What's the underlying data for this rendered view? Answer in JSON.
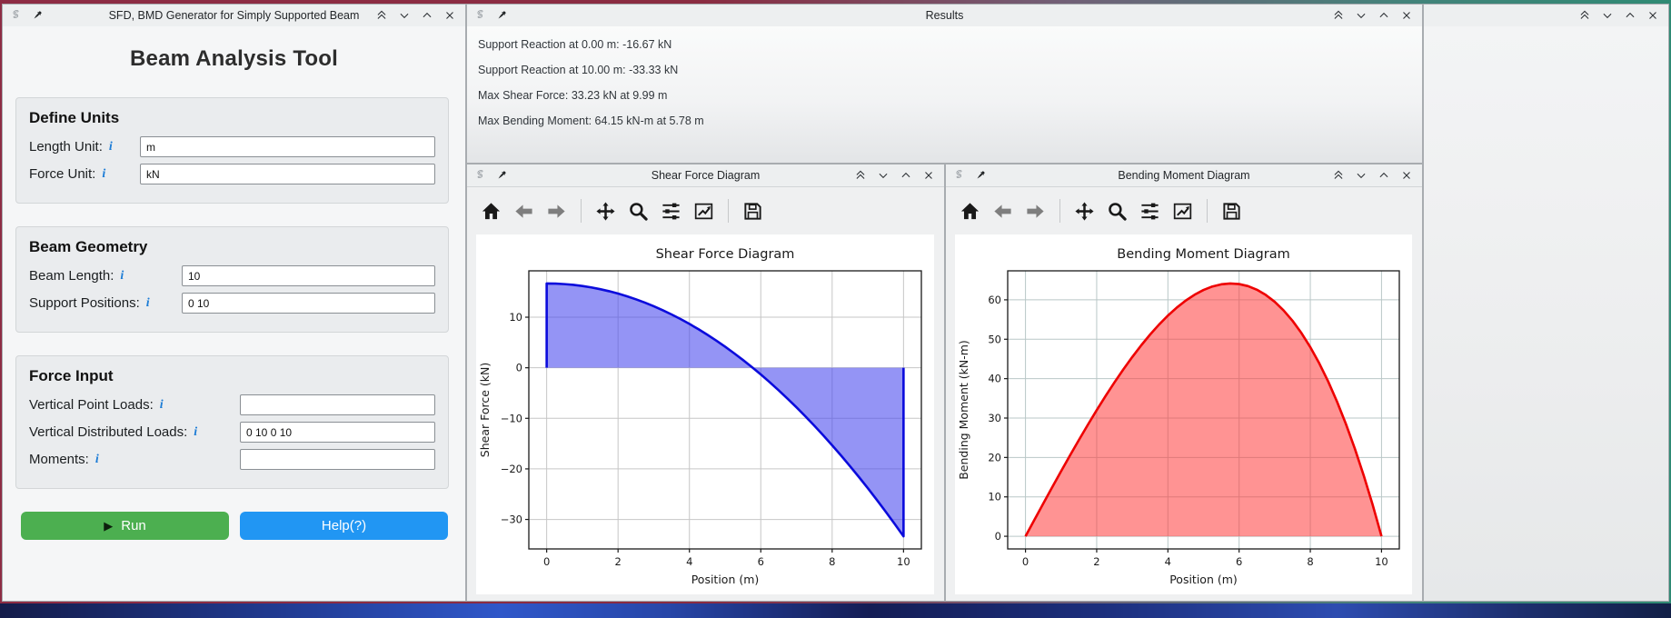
{
  "theme": {
    "frame_gradient": [
      "#8d2c44",
      "#716077",
      "#2f8a74"
    ],
    "desktop_gradient": [
      "#141c4a",
      "#2f57c9",
      "#141d55",
      "#2d4cb0",
      "#122047"
    ],
    "panel_bg": "#eff0f1",
    "titlebar_text": "#232629",
    "run_button_color": "#4caf50",
    "help_button_color": "#2196f3",
    "info_icon_color": "#1c7cd6"
  },
  "window_controls": [
    "shade",
    "minimize",
    "maximize",
    "close"
  ],
  "plot_toolbar": [
    "home",
    "back",
    "forward",
    "pan",
    "zoom",
    "configure-subplots",
    "figure-options",
    "save"
  ],
  "windows": {
    "generator": {
      "title": "SFD, BMD Generator for Simply Supported Beam",
      "heading": "Beam Analysis Tool",
      "run_icon": "▶",
      "run_label": "Run",
      "help_label": "Help(?)",
      "sections": [
        {
          "title": "Define Units",
          "fields": [
            {
              "label": "Length Unit:",
              "info": "i",
              "value": "m"
            },
            {
              "label": "Force Unit:",
              "info": "i",
              "value": "kN"
            }
          ]
        },
        {
          "title": "Beam Geometry",
          "fields": [
            {
              "label": "Beam Length:",
              "info": "i",
              "value": "10"
            },
            {
              "label": "Support Positions:",
              "info": "i",
              "value": "0 10"
            }
          ]
        },
        {
          "title": "Force Input",
          "fields": [
            {
              "label": "Vertical Point Loads:",
              "info": "i",
              "value": ""
            },
            {
              "label": "Vertical Distributed Loads:",
              "info": "i",
              "value": "0 10 0 10"
            },
            {
              "label": "Moments:",
              "info": "i",
              "value": ""
            }
          ]
        }
      ]
    },
    "results": {
      "title": "Results",
      "lines": [
        "Support Reaction at 0.00 m: -16.67 kN",
        "Support Reaction at 10.00 m: -33.33 kN",
        "Max Shear Force: 33.23 kN at 9.99 m",
        "Max Bending Moment: 64.15 kN-m at 5.78 m"
      ]
    },
    "sfd": {
      "title": "Shear Force Diagram"
    },
    "bmd": {
      "title": "Bending Moment Diagram"
    }
  },
  "chart_data": [
    {
      "id": "sfd",
      "type": "area",
      "title": "Shear Force Diagram",
      "xlabel": "Position (m)",
      "ylabel": "Shear Force (kN)",
      "xlim": [
        -0.5,
        10.5
      ],
      "ylim": [
        -35.83,
        19.17
      ],
      "xticks": [
        0,
        2,
        4,
        6,
        8,
        10
      ],
      "xtick_labels": [
        "0",
        "2",
        "4",
        "6",
        "8",
        "10"
      ],
      "yticks": [
        10,
        0,
        -10,
        -20,
        -30
      ],
      "ytick_labels": [
        "10",
        "0",
        "−10",
        "−20",
        "−30"
      ],
      "grid": true,
      "grid_color": "#c6c6c6",
      "legend": "none",
      "line_color": "#0b0bdc",
      "line_width": 2.6,
      "fill_color": "#4646ee",
      "fill_opacity": 0.58,
      "baseline": 0,
      "x": [
        0,
        0,
        0.25,
        0.5,
        0.75,
        1,
        1.25,
        1.5,
        1.75,
        2,
        2.25,
        2.5,
        2.75,
        3,
        3.25,
        3.5,
        3.75,
        4,
        4.25,
        4.5,
        4.75,
        5,
        5.25,
        5.5,
        5.75,
        6,
        6.25,
        6.5,
        6.75,
        7,
        7.25,
        7.5,
        7.75,
        8,
        8.25,
        8.5,
        8.75,
        9,
        9.25,
        9.5,
        9.75,
        10,
        10
      ],
      "y": [
        0,
        16.67,
        16.64,
        16.54,
        16.39,
        16.17,
        15.89,
        15.54,
        15.14,
        14.67,
        14.14,
        13.54,
        12.89,
        12.17,
        11.39,
        10.54,
        9.64,
        8.67,
        7.64,
        6.54,
        5.39,
        4.17,
        2.88,
        1.54,
        0.14,
        -1.33,
        -2.86,
        -4.46,
        -6.11,
        -7.83,
        -9.61,
        -11.46,
        -13.36,
        -15.33,
        -17.36,
        -19.46,
        -21.61,
        -23.83,
        -26.11,
        -28.46,
        -30.86,
        -33.33,
        0
      ]
    },
    {
      "id": "bmd",
      "type": "area",
      "title": "Bending Moment Diagram",
      "xlabel": "Position (m)",
      "ylabel": "Bending Moment (kN-m)",
      "xlim": [
        -0.5,
        10.5
      ],
      "ylim": [
        -3.21,
        67.36
      ],
      "xticks": [
        0,
        2,
        4,
        6,
        8,
        10
      ],
      "xtick_labels": [
        "0",
        "2",
        "4",
        "6",
        "8",
        "10"
      ],
      "yticks": [
        0,
        10,
        20,
        30,
        40,
        50,
        60
      ],
      "ytick_labels": [
        "0",
        "10",
        "20",
        "30",
        "40",
        "50",
        "60"
      ],
      "grid": true,
      "grid_color": "#b9c7c7",
      "legend": "none",
      "line_color": "#ee0000",
      "line_width": 2.6,
      "fill_color": "#ff3b3b",
      "fill_opacity": 0.55,
      "baseline": 0,
      "x": [
        0,
        0.25,
        0.5,
        0.75,
        1,
        1.25,
        1.5,
        1.75,
        2,
        2.25,
        2.5,
        2.75,
        3,
        3.25,
        3.5,
        3.75,
        4,
        4.25,
        4.5,
        4.75,
        5,
        5.25,
        5.5,
        5.75,
        6,
        6.25,
        6.5,
        6.75,
        7,
        7.25,
        7.5,
        7.75,
        8,
        8.25,
        8.5,
        8.75,
        9,
        9.25,
        9.5,
        9.75,
        10
      ],
      "y": [
        0,
        4.16,
        8.31,
        12.43,
        16.5,
        20.51,
        24.44,
        28.27,
        32,
        35.6,
        39.06,
        42.37,
        45.5,
        48.45,
        51.19,
        53.71,
        56,
        58.03,
        59.81,
        61.3,
        62.5,
        63.39,
        63.94,
        64.14,
        64,
        63.48,
        62.57,
        61.24,
        59.5,
        57.32,
        54.69,
        51.59,
        48,
        43.91,
        39.32,
        34.18,
        28.5,
        22.26,
        15.43,
        8.02,
        0
      ]
    }
  ]
}
